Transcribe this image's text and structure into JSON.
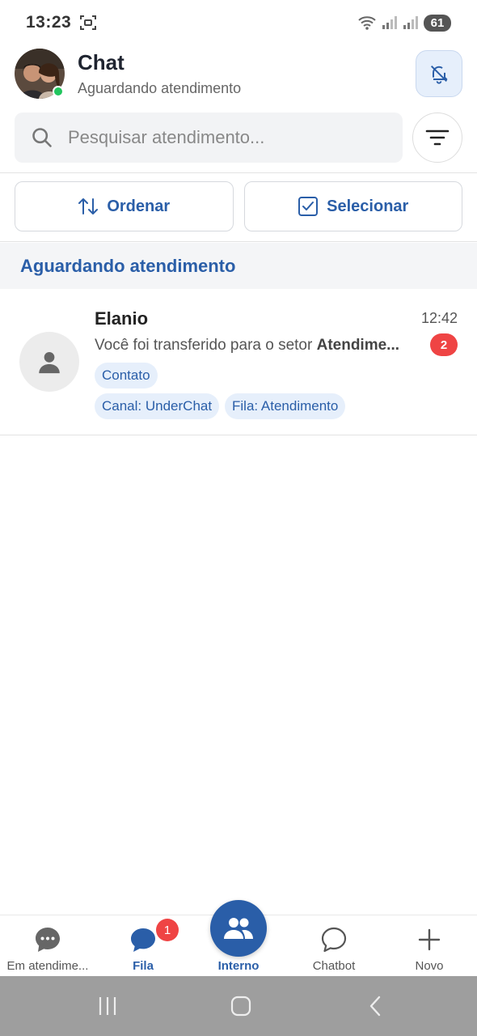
{
  "status_bar": {
    "time": "13:23",
    "battery": "61"
  },
  "header": {
    "title": "Chat",
    "subtitle": "Aguardando atendimento",
    "accent": "#2a5ea8",
    "online_color": "#22c55e"
  },
  "search": {
    "placeholder": "Pesquisar atendimento..."
  },
  "actions": {
    "sort_label": "Ordenar",
    "select_label": "Selecionar"
  },
  "section": {
    "title": "Aguardando atendimento"
  },
  "conversations": [
    {
      "name": "Elanio",
      "time": "12:42",
      "message_prefix": "Você foi transferido para o setor ",
      "message_bold": "Atendime...",
      "unread": "2",
      "tags": [
        "Contato",
        "Canal: UnderChat",
        "Fila: Atendimento"
      ]
    }
  ],
  "bottom_nav": {
    "items": [
      {
        "label": "Em atendime...",
        "icon": "chat-dots-icon"
      },
      {
        "label": "Fila",
        "icon": "chat-bubble-icon",
        "badge": "1"
      },
      {
        "label": "Interno",
        "icon": "group-icon"
      },
      {
        "label": "Chatbot",
        "icon": "chat-outline-icon"
      },
      {
        "label": "Novo",
        "icon": "plus-icon"
      }
    ]
  }
}
